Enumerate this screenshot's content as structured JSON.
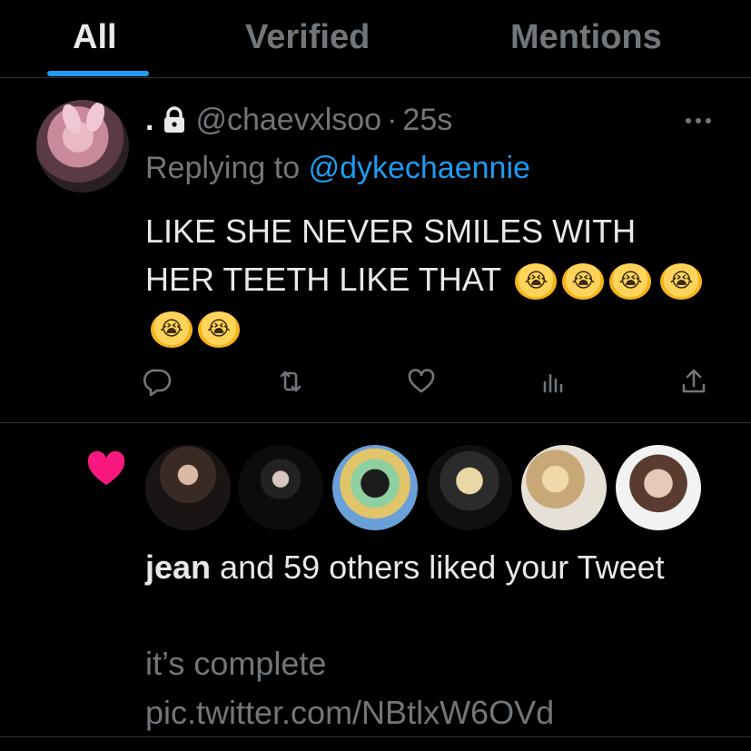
{
  "tabs": [
    {
      "label": "All",
      "active": true
    },
    {
      "label": "Verified",
      "active": false
    },
    {
      "label": "Mentions",
      "active": false
    }
  ],
  "colors": {
    "accent": "#1d9bf0",
    "like_pink": "#f91880",
    "muted_text": "#71767b",
    "primary_text": "#e7e9ea",
    "background": "#000000"
  },
  "tweet": {
    "display_name": ".",
    "protected_icon": "lock-icon",
    "handle": "@chaevxlsoo",
    "separator": "·",
    "time": "25s",
    "more_icon": "more-icon",
    "replying_prefix": "Replying to",
    "replying_to": "@dykechaennie",
    "text": "LIKE SHE NEVER SMILES WITH HER TEETH LIKE THAT",
    "emoji_count": 6,
    "actions": [
      "reply-icon",
      "retweet-icon",
      "like-icon",
      "views-icon",
      "share-icon"
    ]
  },
  "notification": {
    "icon": "heart-icon",
    "liked_by_name": "jean",
    "liked_rest": " and 59 others liked your Tweet",
    "tweet_preview": "it’s complete pic.twitter.com/NBtlxW6OVd"
  }
}
